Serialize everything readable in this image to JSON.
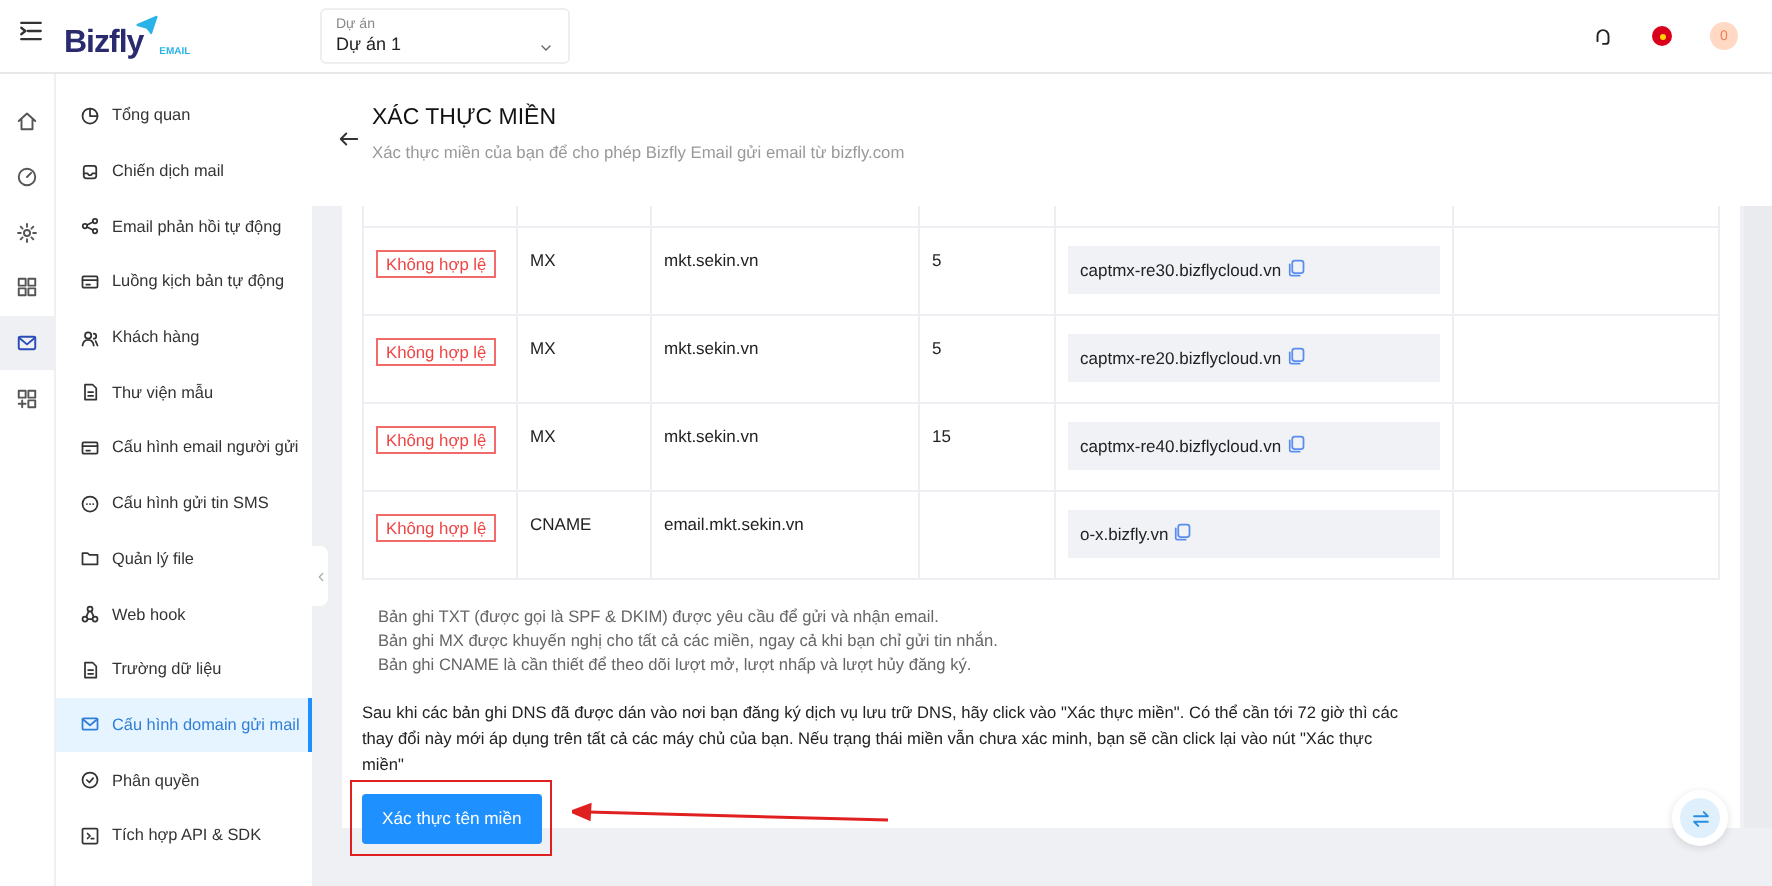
{
  "topbar": {
    "logo": "Bizfly",
    "logo_sub": "EMAIL",
    "project_label": "Dự án",
    "project_value": "Dự án 1",
    "notification_count": "0"
  },
  "rail": [
    {
      "kind": "home",
      "selected": false
    },
    {
      "kind": "gauge",
      "selected": false
    },
    {
      "kind": "gear",
      "selected": false
    },
    {
      "kind": "grid",
      "selected": false
    },
    {
      "kind": "mail",
      "selected": true
    },
    {
      "kind": "grid-plus",
      "selected": false
    }
  ],
  "sidebar": {
    "items": [
      {
        "kind": "pie",
        "label": "Tổng quan",
        "selected": false
      },
      {
        "kind": "inbox",
        "label": "Chiến dịch mail",
        "selected": false
      },
      {
        "kind": "share",
        "label": "Email phản hồi tự động",
        "selected": false
      },
      {
        "kind": "card",
        "label": "Luồng kịch bản tự động",
        "selected": false
      },
      {
        "kind": "users",
        "label": "Khách hàng",
        "selected": false
      },
      {
        "kind": "doc",
        "label": "Thư viện mẫu",
        "selected": false
      },
      {
        "kind": "card",
        "label": "Cấu hình email người gửi",
        "selected": false
      },
      {
        "kind": "chat",
        "label": "Cấu hình gửi tin SMS",
        "selected": false
      },
      {
        "kind": "folder",
        "label": "Quản lý file",
        "selected": false
      },
      {
        "kind": "nodes",
        "label": "Web hook",
        "selected": false
      },
      {
        "kind": "doc",
        "label": "Trường dữ liệu",
        "selected": false
      },
      {
        "kind": "mail",
        "label": "Cấu hình domain gửi mail",
        "selected": true
      },
      {
        "kind": "check",
        "label": "Phân quyền",
        "selected": false
      },
      {
        "kind": "code",
        "label": "Tích hợp API & SDK",
        "selected": false
      }
    ]
  },
  "page": {
    "title": "XÁC THỰC MIỀN",
    "subtitle": "Xác thực miền của bạn để cho phép Bizfly Email gửi email từ bizfly.com"
  },
  "table": {
    "rows": [
      {
        "status": "Không hợp lệ",
        "type": "MX",
        "host": "mkt.sekin.vn",
        "priority": "5",
        "value": "captmx-re30.bizflycloud.vn"
      },
      {
        "status": "Không hợp lệ",
        "type": "MX",
        "host": "mkt.sekin.vn",
        "priority": "5",
        "value": "captmx-re20.bizflycloud.vn"
      },
      {
        "status": "Không hợp lệ",
        "type": "MX",
        "host": "mkt.sekin.vn",
        "priority": "15",
        "value": "captmx-re40.bizflycloud.vn"
      },
      {
        "status": "Không hợp lệ",
        "type": "CNAME",
        "host": "email.mkt.sekin.vn",
        "priority": "",
        "value": "o-x.bizfly.vn"
      }
    ]
  },
  "notes": [
    "Bản ghi TXT (được gọi là SPF & DKIM) được yêu cầu để gửi và nhận email.",
    "Bản ghi MX được khuyến nghị cho tất cả các miền, ngay cả khi bạn chỉ gửi tin nhắn.",
    "Bản ghi CNAME là cần thiết để theo dõi lượt mở, lượt nhấp và lượt hủy đăng ký."
  ],
  "instruction": "Sau khi các bản ghi DNS đã được dán vào nơi bạn đăng ký dịch vụ lưu trữ DNS, hãy click vào \"Xác thực miền\". Có thể cần tới 72 giờ thì các thay đổi này mới áp dụng trên tất cả các máy chủ của bạn. Nếu trạng thái miền vẫn chưa xác minh, bạn sẽ cần click lại vào nút \"Xác thực miền\"",
  "verify_button": "Xác thực tên miền"
}
